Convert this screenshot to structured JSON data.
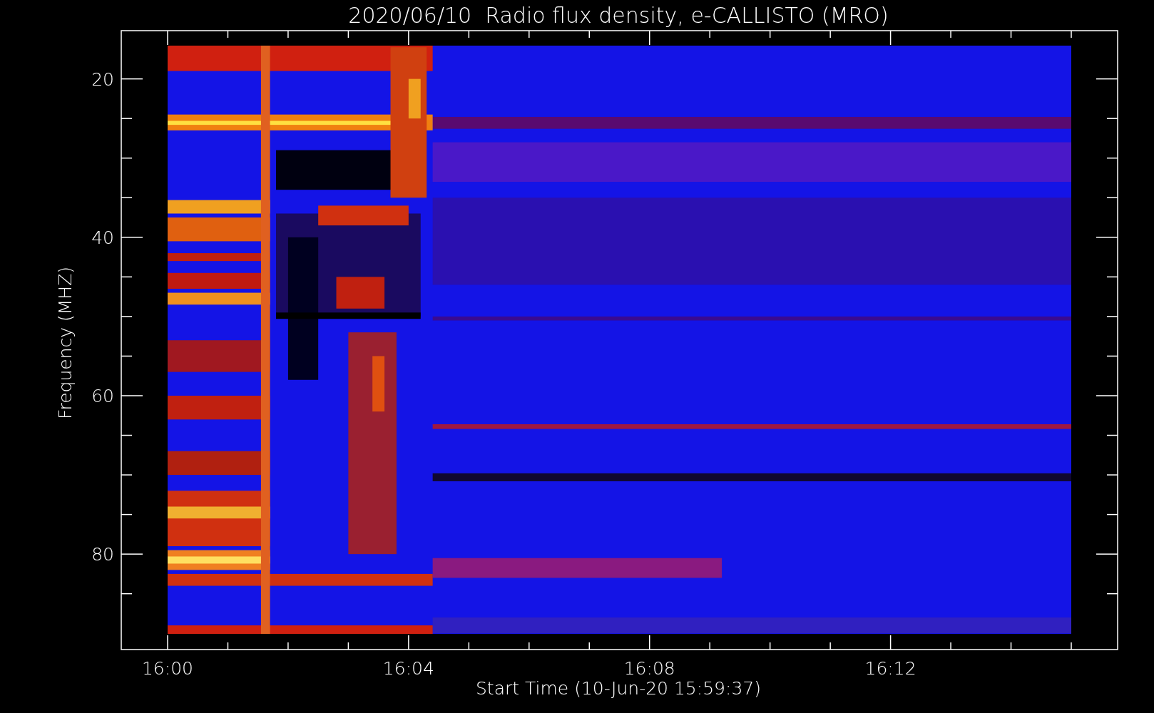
{
  "plot": {
    "title": "2020/06/10  Radio flux density, e-CALLISTO (MRO)",
    "ylabel": "Frequency (MHZ)",
    "xlabel": "Start Time (10-Jun-20 15:59:37)",
    "yticks": [
      "20",
      "40",
      "60",
      "80"
    ],
    "xticks": [
      "16:00",
      "16:04",
      "16:08",
      "16:12"
    ]
  }
}
